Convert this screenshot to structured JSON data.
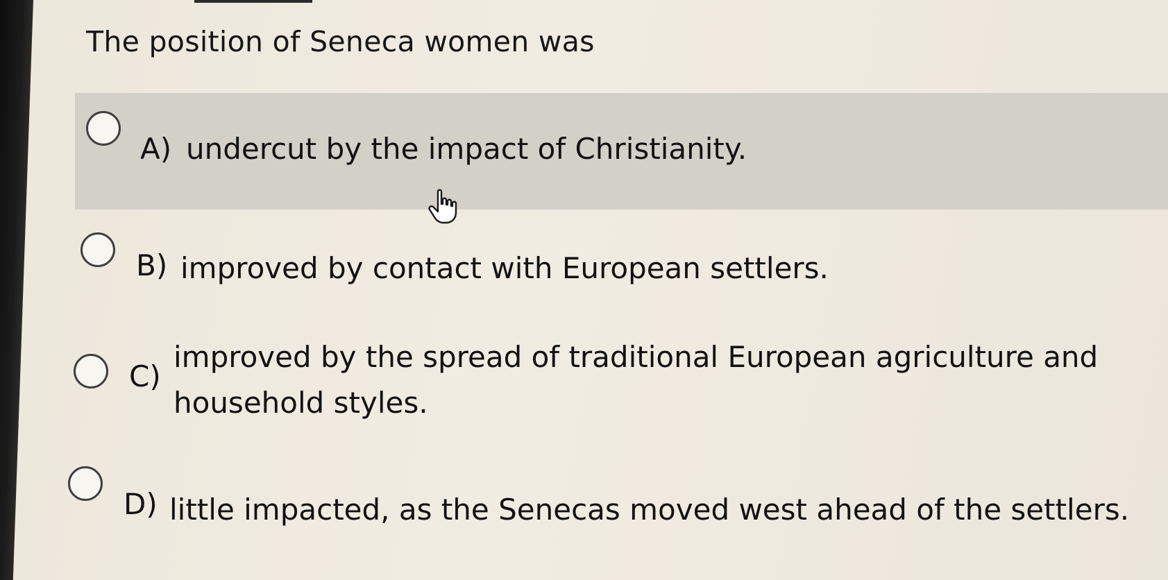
{
  "question": {
    "text": "The position of Seneca women was"
  },
  "options": [
    {
      "letter": "A)",
      "text": "undercut by the impact of Christianity.",
      "selected": false,
      "hovered": true
    },
    {
      "letter": "B)",
      "text": "improved by contact with European settlers.",
      "selected": false,
      "hovered": false
    },
    {
      "letter": "C)",
      "text": "improved by the spread of traditional European agriculture and household styles.",
      "selected": false,
      "hovered": false
    },
    {
      "letter": "D)",
      "text": "little impacted, as the Senecas moved west ahead of the settlers.",
      "selected": false,
      "hovered": false
    }
  ],
  "cursor": {
    "icon": "hand-pointer-icon"
  },
  "colors": {
    "background": "#eee9df",
    "hover_row": "#d3d0c8",
    "text": "#121212"
  }
}
